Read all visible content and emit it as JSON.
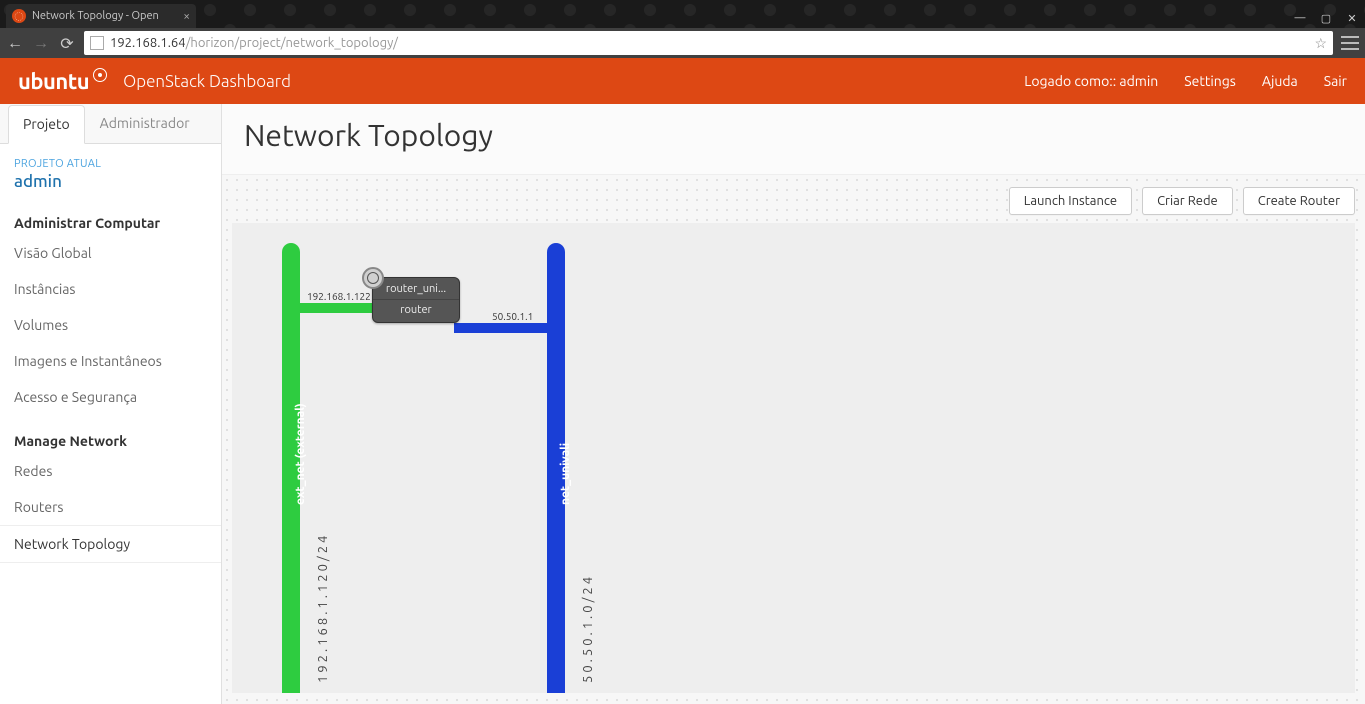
{
  "browser": {
    "tab_title": "Network Topology - Open",
    "url_host": "192.168.1.64",
    "url_path": "/horizon/project/network_topology/"
  },
  "header": {
    "brand_bold": "ubuntu",
    "product": "OpenStack Dashboard",
    "logged_as_label": "Logado como::",
    "logged_as_user": "admin",
    "settings": "Settings",
    "help": "Ajuda",
    "signout": "Sair"
  },
  "side_tabs": {
    "project": "Projeto",
    "admin": "Administrador"
  },
  "sidebar": {
    "current_project_label": "PROJETO ATUAL",
    "current_project": "admin",
    "section_compute": "Administrar Computar",
    "compute_items": [
      "Visão Global",
      "Instâncias",
      "Volumes",
      "Imagens e Instantâneos",
      "Acesso e Segurança"
    ],
    "section_network": "Manage Network",
    "network_items": [
      "Redes",
      "Routers",
      "Network Topology"
    ],
    "active_item": "Network Topology"
  },
  "page": {
    "title": "Network Topology",
    "buttons": {
      "launch": "Launch Instance",
      "create_net": "Criar Rede",
      "create_router": "Create Router"
    }
  },
  "topology": {
    "networks": [
      {
        "id": "ext",
        "label": "ext_net (external)",
        "cidr": "192.168.1.120/24",
        "color": "green"
      },
      {
        "id": "int",
        "label": "net_univali",
        "cidr": "50.50.1.0/24",
        "color": "blue"
      }
    ],
    "router": {
      "name": "router_uni...",
      "type": "router",
      "ip_left": "192.168.1.122",
      "ip_right": "50.50.1.1"
    }
  }
}
